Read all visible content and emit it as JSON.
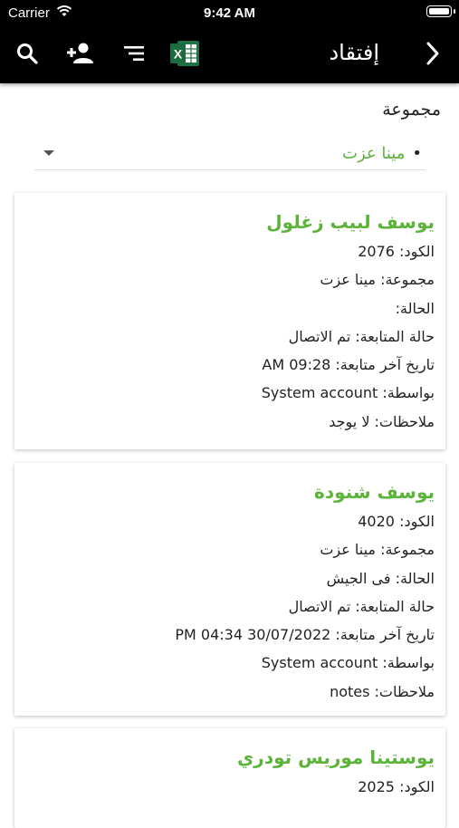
{
  "status_bar": {
    "carrier": "Carrier",
    "time": "9:42 AM"
  },
  "toolbar": {
    "title": "إفتقاد",
    "icons": [
      "search-icon",
      "add-person-icon",
      "filter-icon",
      "excel-icon",
      "chevron-right-icon"
    ],
    "excel_letter": "X"
  },
  "filter": {
    "label": "مجموعة",
    "selected": "مينا عزت",
    "bullet": "•"
  },
  "accent_color": "#5bb33a",
  "cards": [
    {
      "name": "يوسف لبيب زغلول",
      "code": "الكود: 2076",
      "group": "مجموعة: مينا عزت",
      "state": "الحالة:",
      "followup_state": "حالة المتابعة: تم الاتصال",
      "last_followup": "تاريخ آخر متابعة: 09:28 AM",
      "by": "بواسطة: System account",
      "notes": "ملاحظات: لا يوجد"
    },
    {
      "name": "يوسف شنودة",
      "code": "الكود: 4020",
      "group": "مجموعة: مينا عزت",
      "state": "الحالة: فى الجيش",
      "followup_state": "حالة المتابعة: تم الاتصال",
      "last_followup": "تاريخ آخر متابعة: 30/07/2022 04:34 PM",
      "by": "بواسطة: System account",
      "notes": "ملاحظات: notes"
    },
    {
      "name": "يوستينا موريس تودري",
      "code": "الكود: 2025"
    }
  ]
}
